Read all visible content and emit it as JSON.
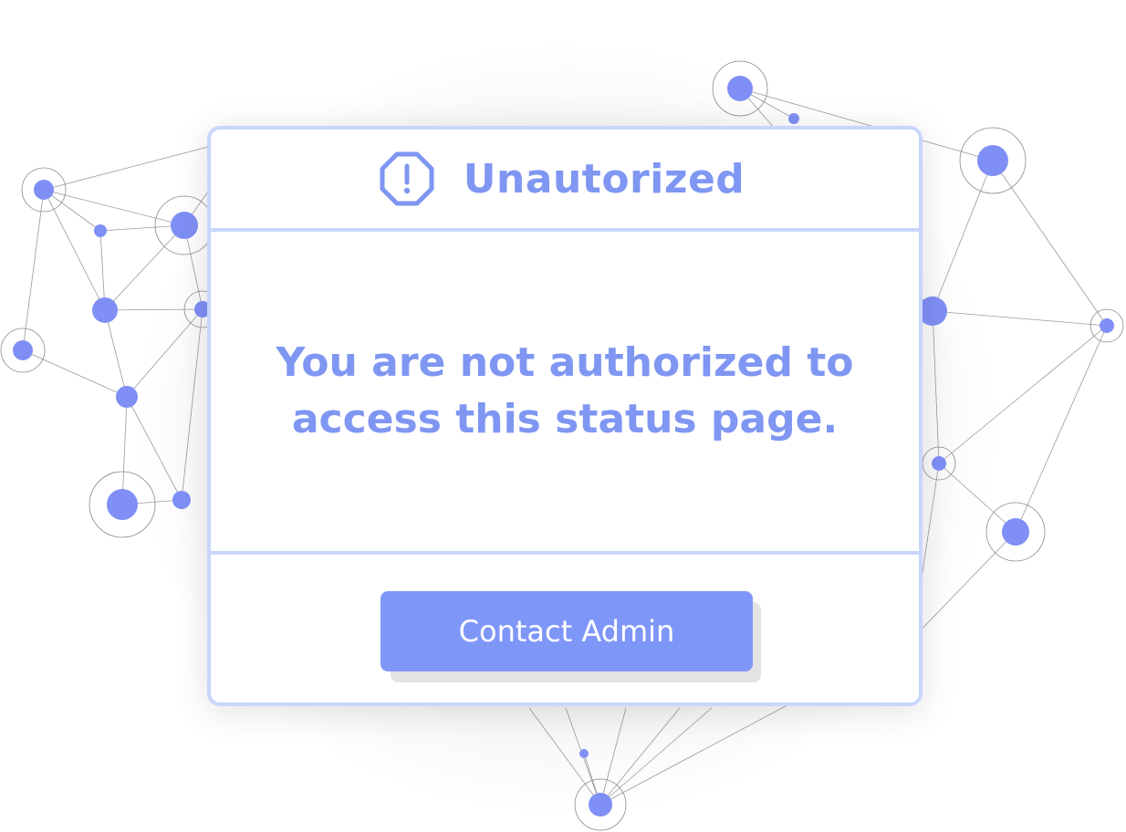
{
  "dialog": {
    "title": "Unautorized",
    "message": "You are not authorized to access this status page.",
    "button_label": "Contact Admin",
    "icon": "alert-octagon-icon"
  },
  "colors": {
    "accent": "#7f96f2",
    "button": "#7f96f9",
    "border": "#c8d6fb",
    "node": "#7f8ff5"
  }
}
